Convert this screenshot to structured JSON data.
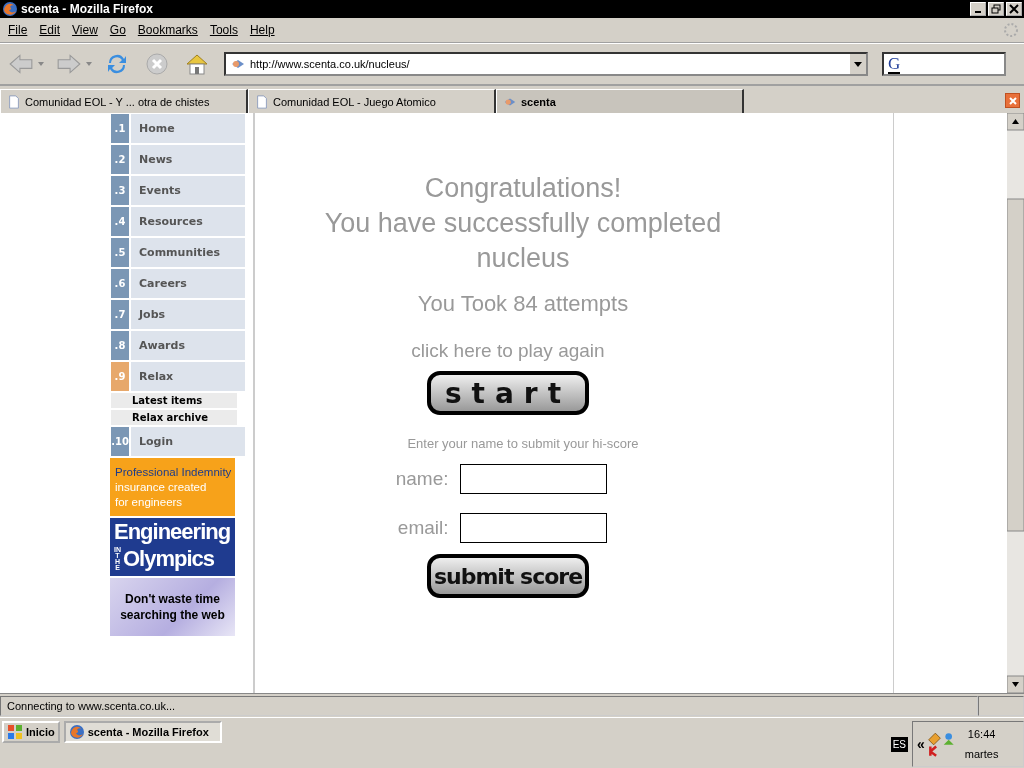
{
  "window": {
    "title": "scenta - Mozilla Firefox"
  },
  "menu": [
    "File",
    "Edit",
    "View",
    "Go",
    "Bookmarks",
    "Tools",
    "Help"
  ],
  "address": {
    "value": "http://www.scenta.co.uk/nucleus/"
  },
  "search_engine": "G",
  "tabs": [
    {
      "label": "Comunidad EOL - Y ... otra de chistes",
      "selected": false
    },
    {
      "label": "Comunidad EOL - Juego Atomico",
      "selected": false
    },
    {
      "label": "scenta",
      "selected": true
    }
  ],
  "sidebar": {
    "items": [
      {
        "number": ".1",
        "label": "Home",
        "selected": false
      },
      {
        "number": ".2",
        "label": "News",
        "selected": false
      },
      {
        "number": ".3",
        "label": "Events",
        "selected": false
      },
      {
        "number": ".4",
        "label": "Resources",
        "selected": false
      },
      {
        "number": ".5",
        "label": "Communities",
        "selected": false
      },
      {
        "number": ".6",
        "label": "Careers",
        "selected": false
      },
      {
        "number": ".7",
        "label": "Jobs",
        "selected": false
      },
      {
        "number": ".8",
        "label": "Awards",
        "selected": false
      },
      {
        "number": ".9",
        "label": "Relax",
        "selected": true,
        "children": [
          {
            "label": "Latest items"
          },
          {
            "label": "Relax archive"
          }
        ]
      },
      {
        "number": ".10",
        "label": "Login",
        "selected": false
      }
    ],
    "ads": [
      {
        "kind": "indemnity",
        "lines": [
          "Professional Indemnity",
          "insurance created",
          "for engineers"
        ]
      },
      {
        "kind": "olympics",
        "lines": [
          "Engineering",
          "IN THE",
          "Olympics"
        ]
      },
      {
        "kind": "search",
        "lines": [
          "Don't waste time",
          "searching the web"
        ]
      }
    ]
  },
  "main": {
    "heading": [
      "Congratulations!",
      "You have successfully completed",
      "nucleus"
    ],
    "attempts": "You Took 84 attempts",
    "play_again": "click here to play again",
    "start_button": "start",
    "prompt": "Enter your name to submit your hi-score",
    "fields": [
      {
        "label": "name:"
      },
      {
        "label": "email:"
      }
    ],
    "submit_button": "submit score"
  },
  "status_bar": "Connecting to www.scenta.co.uk...",
  "taskbar": {
    "start": "Inicio",
    "task": "scenta - Mozilla Firefox",
    "language": "ES",
    "expand": "«",
    "time": "16:44",
    "day": "martes"
  }
}
